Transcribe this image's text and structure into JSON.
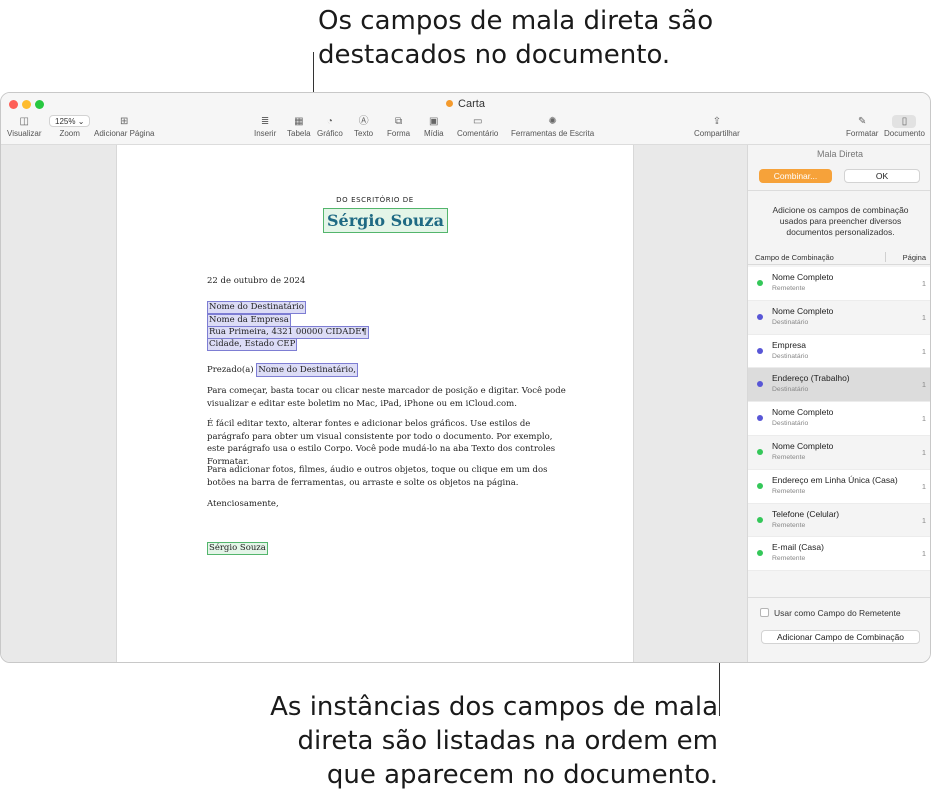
{
  "callouts": {
    "top_line1": "Os campos de mala direta são",
    "top_line2": "destacados no documento.",
    "bottom_line1": "As instâncias dos campos de mala",
    "bottom_line2": "direta são listadas na ordem em",
    "bottom_line3": "que aparecem no documento."
  },
  "window": {
    "title": "Carta",
    "toolbar": {
      "visualizar": "Visualizar",
      "zoom_value": "125%",
      "zoom": "Zoom",
      "adicionar_pagina": "Adicionar Página",
      "inserir": "Inserir",
      "tabela": "Tabela",
      "grafico": "Gráfico",
      "texto": "Texto",
      "forma": "Forma",
      "midia": "Mídia",
      "comentario": "Comentário",
      "ferramentas": "Ferramentas de Escrita",
      "compartilhar": "Compartilhar",
      "formatar": "Formatar",
      "documento": "Documento"
    }
  },
  "document": {
    "office_heading": "DO ESCRITÓRIO DE",
    "sender_name": "Sérgio Souza",
    "date": "22 de outubro de 2024",
    "address": [
      "Nome do Destinatário",
      "Nome da Empresa",
      "Rua Primeira, 4321 00000 CIDADE¶",
      "Cidade, Estado CEP"
    ],
    "greeting_prefix": "Prezado(a)",
    "greeting_field": "Nome do Destinatário,",
    "paragraphs": [
      "Para começar, basta tocar ou clicar neste marcador de posição e digitar. Você pode visualizar e editar este boletim no Mac, iPad, iPhone ou em iCloud.com.",
      "É fácil editar texto, alterar fontes e adicionar belos gráficos. Use estilos de parágrafo para obter um visual consistente por todo o documento. Por exemplo, este parágrafo usa o estilo Corpo. Você pode mudá-lo na aba Texto dos controles Formatar.",
      "Para adicionar fotos, filmes, áudio e outros objetos, toque ou clique em um dos botões na barra de ferramentas, ou arraste e solte os objetos na página."
    ],
    "closing": "Atenciosamente,",
    "signature": "Sérgio Souza"
  },
  "sidebar": {
    "title": "Mala Direta",
    "merge_button": "Combinar...",
    "ok_button": "OK",
    "description": "Adicione os campos de combinação usados para preencher diversos documentos personalizados.",
    "col_field": "Campo de Combinação",
    "col_page": "Página",
    "fields": [
      {
        "name": "Nome Completo",
        "type": "Remetente",
        "page": "1",
        "color": "#34c759"
      },
      {
        "name": "Nome Completo",
        "type": "Destinatário",
        "page": "1",
        "color": "#5856d6"
      },
      {
        "name": "Empresa",
        "type": "Destinatário",
        "page": "1",
        "color": "#5856d6"
      },
      {
        "name": "Endereço (Trabalho)",
        "type": "Destinatário",
        "page": "1",
        "color": "#5856d6"
      },
      {
        "name": "Nome Completo",
        "type": "Destinatário",
        "page": "1",
        "color": "#5856d6"
      },
      {
        "name": "Nome Completo",
        "type": "Remetente",
        "page": "1",
        "color": "#34c759"
      },
      {
        "name": "Endereço em Linha Única (Casa)",
        "type": "Remetente",
        "page": "1",
        "color": "#34c759"
      },
      {
        "name": "Telefone (Celular)",
        "type": "Remetente",
        "page": "1",
        "color": "#34c759"
      },
      {
        "name": "E-mail (Casa)",
        "type": "Remetente",
        "page": "1",
        "color": "#34c759"
      }
    ],
    "checkbox_label": "Usar como Campo do Remetente",
    "add_button": "Adicionar Campo de Combinação"
  }
}
